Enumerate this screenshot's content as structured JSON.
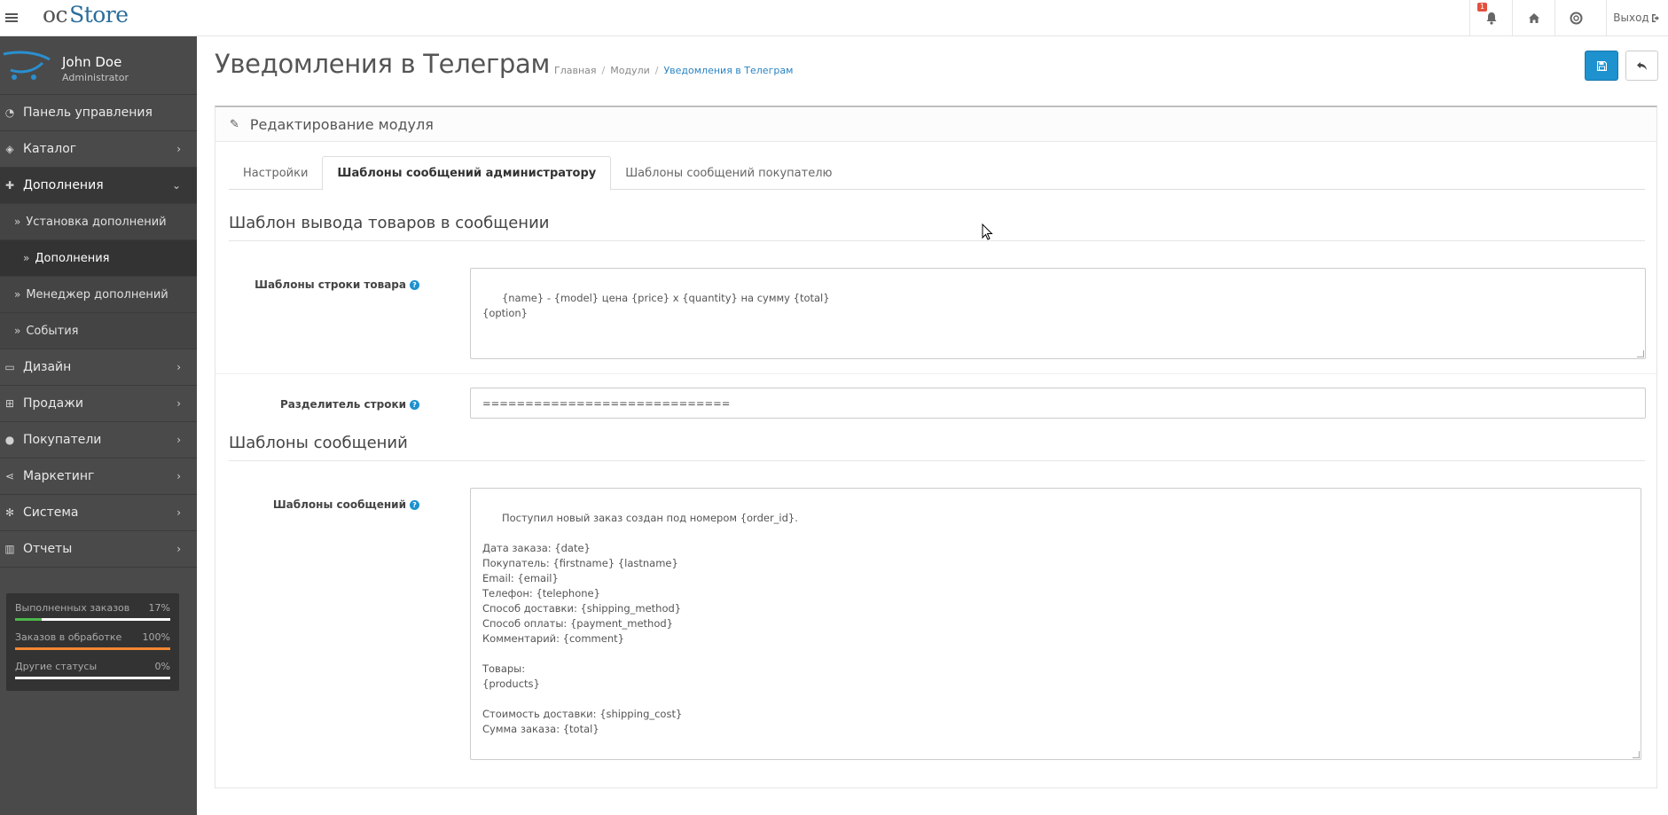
{
  "header": {
    "logo_oc": "oc",
    "logo_store": "Store",
    "notification_count": "1",
    "logout_label": "Выход"
  },
  "sidebar": {
    "user_name": "John Doe",
    "user_role": "Administrator",
    "items": [
      {
        "label": "Панель управления",
        "icon": "dashboard-icon"
      },
      {
        "label": "Каталог",
        "icon": "tags-icon"
      },
      {
        "label": "Дополнения",
        "icon": "puzzle-icon"
      },
      {
        "label": "Дизайн",
        "icon": "monitor-icon"
      },
      {
        "label": "Продажи",
        "icon": "cart-icon"
      },
      {
        "label": "Покупатели",
        "icon": "user-icon"
      },
      {
        "label": "Маркетинг",
        "icon": "share-icon"
      },
      {
        "label": "Система",
        "icon": "cog-icon"
      },
      {
        "label": "Отчеты",
        "icon": "bar-chart-icon"
      }
    ],
    "subitems": [
      {
        "label": "Установка дополнений"
      },
      {
        "label": "Дополнения"
      },
      {
        "label": "Менеджер дополнений"
      },
      {
        "label": "События"
      }
    ],
    "stats": [
      {
        "label": "Выполненных заказов",
        "value": "17%",
        "fill": 0.17,
        "color": "#4cb64c"
      },
      {
        "label": "Заказов в обработке",
        "value": "100%",
        "fill": 1.0,
        "color": "#f38733"
      },
      {
        "label": "Другие статусы",
        "value": "0%",
        "fill": 0.0,
        "color": "#e3503e"
      }
    ]
  },
  "page": {
    "title": "Уведомления в Телеграм",
    "breadcrumb": [
      "Главная",
      "Модули",
      "Уведомления в Телеграм"
    ]
  },
  "panel": {
    "heading": "Редактирование модуля",
    "tabs": [
      "Настройки",
      "Шаблоны сообщений администратору",
      "Шаблоны сообщений покупателю"
    ],
    "section1_title": "Шаблон вывода товаров в сообщении",
    "product_line_label": "Шаблоны строки товара",
    "product_line_value": "{name} - {model} цена {price} x {quantity} на сумму {total}\n{option}",
    "separator_label": "Разделитель строки",
    "separator_value": "=============================",
    "section2_title": "Шаблоны сообщений",
    "messages_label": "Шаблоны сообщений",
    "messages_value": "Поступил новый заказ создан под номером {order_id}.\n\nДата заказа: {date}\nПокупатель: {firstname} {lastname}\nEmail: {email}\nТелефон: {telephone}\nСпособ доставки: {shipping_method}\nСпособ оплаты: {payment_method}\nКомментарий: {comment}\n\nТовары:\n{products}\n\nСтоимость доставки: {shipping_cost}\nСумма заказа: {total}"
  }
}
